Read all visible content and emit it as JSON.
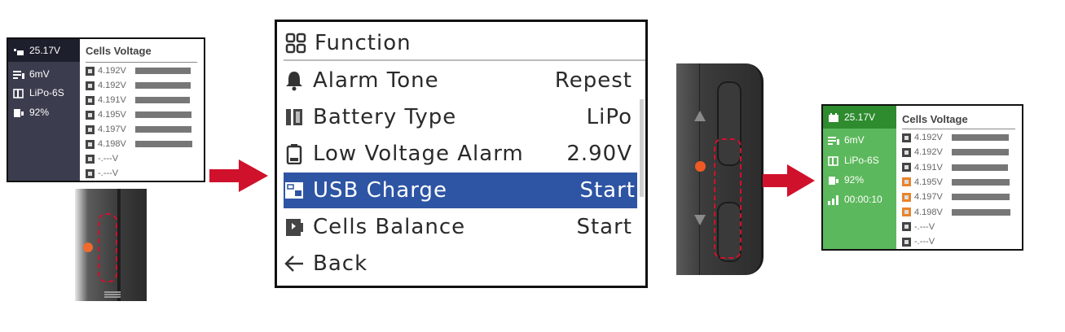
{
  "left_screen": {
    "sidebar": {
      "voltage": "25.17V",
      "resistance": "6mV",
      "battery": "LiPo-6S",
      "percent": "92%"
    },
    "title": "Cells Voltage",
    "cells": [
      "4.192V",
      "4.192V",
      "4.191V",
      "4.195V",
      "4.197V",
      "4.198V",
      "-.---V",
      "-.---V"
    ],
    "bar_fractions": [
      0.97,
      0.97,
      0.96,
      0.98,
      0.99,
      1.0,
      0,
      0
    ],
    "colors": {
      "sidebar": "#3b3d4f",
      "header": "#1d1f2c"
    }
  },
  "menu": {
    "title": "Function",
    "items": [
      {
        "label": "Alarm Tone",
        "value": "Repest",
        "icon": "bell-icon"
      },
      {
        "label": "Battery Type",
        "value": "LiPo",
        "icon": "battery-type-icon"
      },
      {
        "label": "Low Voltage Alarm",
        "value": "2.90V",
        "icon": "low-battery-icon"
      },
      {
        "label": "USB Charge",
        "value": "Start",
        "icon": "usb-icon",
        "selected": true
      },
      {
        "label": "Cells Balance",
        "value": "Start",
        "icon": "balance-icon"
      },
      {
        "label": "Back",
        "value": "",
        "icon": "back-arrow-icon"
      }
    ],
    "colors": {
      "selected": "#2e55a4"
    }
  },
  "right_screen": {
    "sidebar": {
      "voltage": "25.17V",
      "resistance": "6mV",
      "battery": "LiPo-6S",
      "percent": "92%",
      "timer": "00:00:10"
    },
    "title": "Cells Voltage",
    "cells": [
      "4.192V",
      "4.192V",
      "4.191V",
      "4.195V",
      "4.197V",
      "4.198V",
      "-.---V",
      "-.---V"
    ],
    "bar_fractions": [
      0.97,
      0.97,
      0.96,
      0.98,
      0.99,
      1.0,
      0,
      0
    ],
    "colors": {
      "sidebar": "#5cb85c",
      "header": "#2e8b2e",
      "balancing": "#e8842c"
    }
  },
  "arrow_color": "#d0112b"
}
